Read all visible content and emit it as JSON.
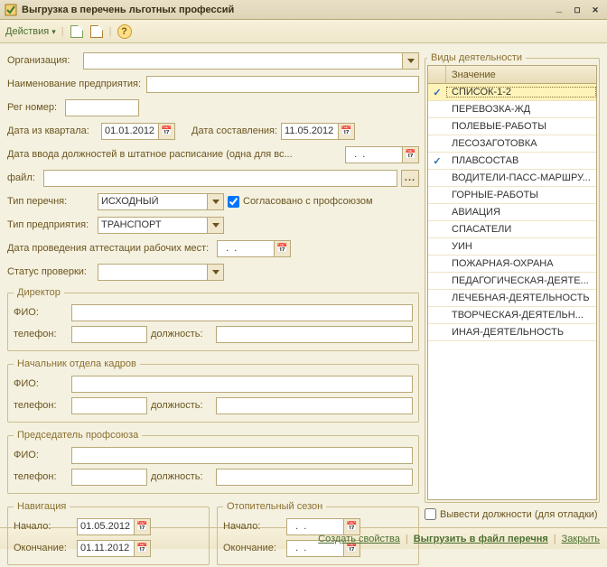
{
  "window": {
    "title": "Выгрузка в перечень льготных профессий"
  },
  "actionbar": {
    "actions": "Действия"
  },
  "labels": {
    "org": "Организация:",
    "company_name": "Наименование предприятия:",
    "reg_no": "Рег номер:",
    "quarter_date": "Дата из квартала:",
    "compose_date": "Дата составления:",
    "positions_date": "Дата ввода должностей в штатное расписание (одна для вс...",
    "file": "файл:",
    "list_type": "Тип перечня:",
    "agreed": "Согласовано с профсоюзом",
    "company_type": "Тип предприятия:",
    "attestation_date": "Дата проведения аттестации рабочих мест:",
    "check_status": "Статус проверки:",
    "fio": "ФИО:",
    "phone": "телефон:",
    "position": "должность:",
    "start": "Начало:",
    "end": "Окончание:"
  },
  "values": {
    "org": "",
    "company_name": "",
    "reg_no": "",
    "quarter_date": "01.01.2012",
    "compose_date": "11.05.2012",
    "positions_date": "  .  .    ",
    "file": "",
    "list_type": "ИСХОДНЫЙ",
    "agreed_checked": true,
    "company_type": "ТРАНСПОРТ",
    "attestation_date": "  .  .    ",
    "check_status": "",
    "director": {
      "fio": "",
      "phone": "",
      "position": ""
    },
    "hr_chief": {
      "fio": "",
      "phone": "",
      "position": ""
    },
    "union_chair": {
      "fio": "",
      "phone": "",
      "position": ""
    },
    "nav": {
      "start": "01.05.2012",
      "end": "01.11.2012"
    },
    "heating": {
      "start": "  .  .    ",
      "end": "  .  .    "
    },
    "debug_positions": false
  },
  "groups": {
    "director": "Директор",
    "hr_chief": "Начальник отдела кадров",
    "union_chair": "Председатель профсоюза",
    "navigation": "Навигация",
    "heating": "Отопительный сезон",
    "activities": "Виды деятельности"
  },
  "activities": {
    "header": "Значение",
    "rows": [
      {
        "checked": true,
        "value": "СПИСОК-1-2",
        "selected": true
      },
      {
        "checked": false,
        "value": "ПЕРЕВОЗКА-ЖД"
      },
      {
        "checked": false,
        "value": "ПОЛЕВЫЕ-РАБОТЫ"
      },
      {
        "checked": false,
        "value": "ЛЕСОЗАГОТОВКА"
      },
      {
        "checked": true,
        "value": "ПЛАВСОСТАВ"
      },
      {
        "checked": false,
        "value": "ВОДИТЕЛИ-ПАСС-МАРШРУ..."
      },
      {
        "checked": false,
        "value": "ГОРНЫЕ-РАБОТЫ"
      },
      {
        "checked": false,
        "value": "АВИАЦИЯ"
      },
      {
        "checked": false,
        "value": "СПАСАТЕЛИ"
      },
      {
        "checked": false,
        "value": "УИН"
      },
      {
        "checked": false,
        "value": "ПОЖАРНАЯ-ОХРАНА"
      },
      {
        "checked": false,
        "value": "ПЕДАГОГИЧЕСКАЯ-ДЕЯТЕ..."
      },
      {
        "checked": false,
        "value": "ЛЕЧЕБНАЯ-ДЕЯТЕЛЬНОСТЬ"
      },
      {
        "checked": false,
        "value": "ТВОРЧЕСКАЯ-ДЕЯТЕЛЬН..."
      },
      {
        "checked": false,
        "value": "ИНАЯ-ДЕЯТЕЛЬНОСТЬ"
      }
    ]
  },
  "debug_label": "Вывести должности (для отладки)",
  "footer": {
    "create_props": "Создать свойства",
    "export": "Выгрузить в файл перечня",
    "close": "Закрыть"
  }
}
